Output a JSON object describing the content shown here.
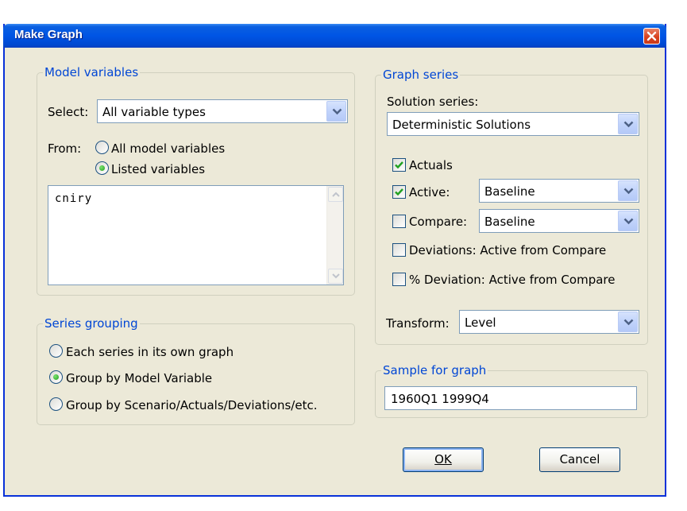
{
  "window": {
    "title": "Make Graph"
  },
  "model_variables": {
    "legend": "Model variables",
    "select_label": "Select:",
    "select_value": "All variable types",
    "from_label": "From:",
    "from_options": [
      "All model variables",
      "Listed variables"
    ],
    "from_selected": "Listed variables",
    "variables_text": "cniry"
  },
  "series_grouping": {
    "legend": "Series grouping",
    "options": [
      "Each series in its own graph",
      "Group by Model Variable",
      "Group by Scenario/Actuals/Deviations/etc."
    ],
    "selected": "Group by Model Variable"
  },
  "graph_series": {
    "legend": "Graph series",
    "solution_label": "Solution series:",
    "solution_value": "Deterministic Solutions",
    "actuals_label": "Actuals",
    "actuals_checked": true,
    "active_label": "Active:",
    "active_checked": true,
    "active_value": "Baseline",
    "compare_label": "Compare:",
    "compare_checked": false,
    "compare_value": "Baseline",
    "deviations_label": "Deviations: Active from Compare",
    "deviations_checked": false,
    "pct_deviation_label": "% Deviation: Active from Compare",
    "pct_deviation_checked": false,
    "transform_label": "Transform:",
    "transform_value": "Level"
  },
  "sample": {
    "legend": "Sample for graph",
    "value": "1960Q1 1999Q4"
  },
  "buttons": {
    "ok_label": "OK",
    "cancel_label": "Cancel"
  },
  "icons": {
    "close": "close-icon",
    "dropdown": "chevron-down-icon",
    "check": "checkmark-icon",
    "scroll_up": "scroll-up-icon",
    "scroll_down": "scroll-down-icon"
  },
  "colors": {
    "title_bar": "#0055e5",
    "dialog_bg": "#ece9d8",
    "legend_text": "#0046d5",
    "check_mark": "#21a121"
  }
}
